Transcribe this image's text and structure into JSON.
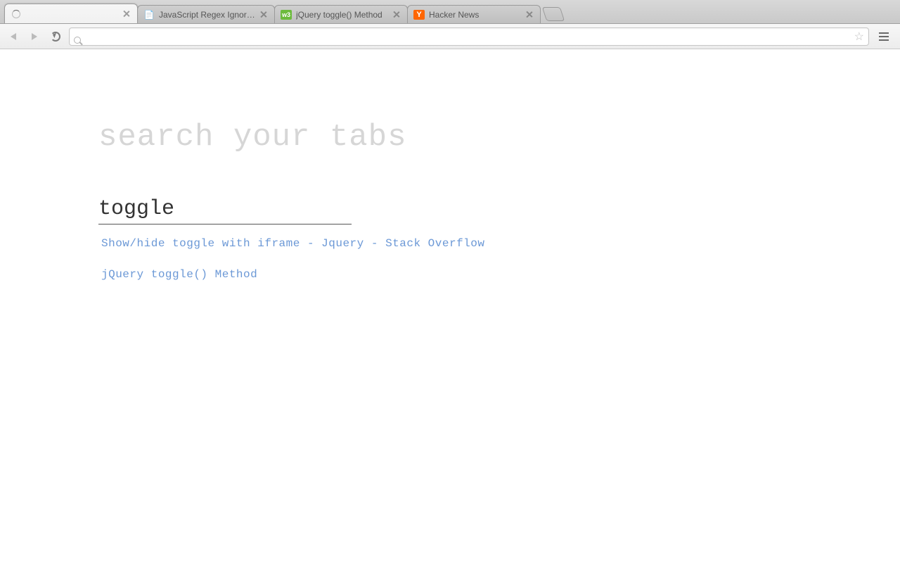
{
  "tabs": [
    {
      "title": "",
      "favicon": "loading",
      "active": true
    },
    {
      "title": "JavaScript Regex Ignore Ca",
      "favicon": "stack"
    },
    {
      "title": "jQuery toggle() Method",
      "favicon": "w3"
    },
    {
      "title": "Hacker News",
      "favicon": "hn"
    }
  ],
  "omnibox": {
    "value": "",
    "placeholder": ""
  },
  "page": {
    "heading": "search your tabs",
    "search_value": "toggle",
    "results": [
      "Show/hide toggle with iframe - Jquery - Stack Overflow",
      "jQuery toggle() Method"
    ]
  },
  "favicon_labels": {
    "w3": "w3",
    "hn": "Y"
  }
}
